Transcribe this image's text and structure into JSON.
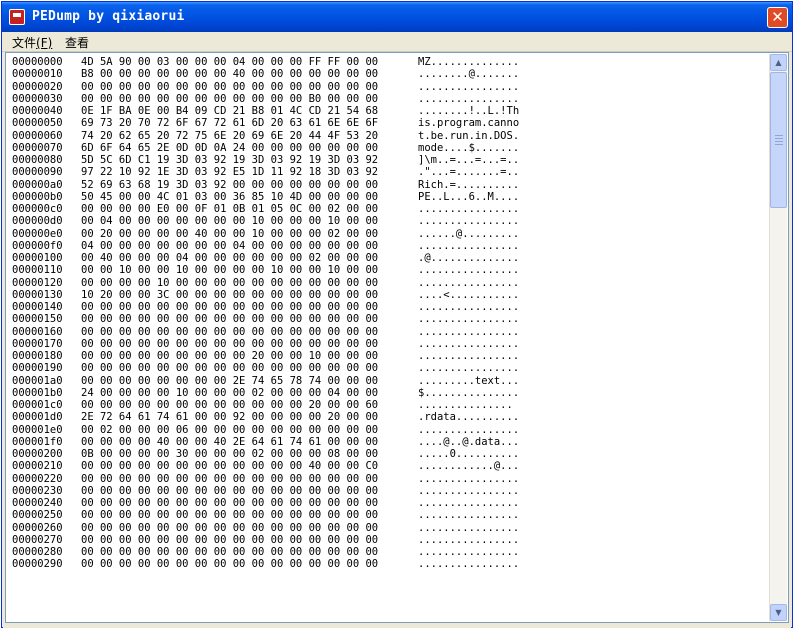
{
  "window": {
    "title": "PEDump by qixiaorui",
    "close_glyph": "✕"
  },
  "menu": [
    {
      "label": "文件",
      "accel": "(F)"
    },
    {
      "label": "查看",
      "accel": ""
    }
  ],
  "scrollbar": {
    "up_arrow": "▲",
    "down_arrow": "▼"
  },
  "hex_rows": [
    {
      "offset": "00000000",
      "hex": "4D 5A 90 00 03 00 00 00 04 00 00 00 FF FF 00 00",
      "ascii": "MZ.............."
    },
    {
      "offset": "00000010",
      "hex": "B8 00 00 00 00 00 00 00 40 00 00 00 00 00 00 00",
      "ascii": "........@......."
    },
    {
      "offset": "00000020",
      "hex": "00 00 00 00 00 00 00 00 00 00 00 00 00 00 00 00",
      "ascii": "................"
    },
    {
      "offset": "00000030",
      "hex": "00 00 00 00 00 00 00 00 00 00 00 00 B0 00 00 00",
      "ascii": "................"
    },
    {
      "offset": "00000040",
      "hex": "0E 1F BA 0E 00 B4 09 CD 21 B8 01 4C CD 21 54 68",
      "ascii": "........!..L.!Th"
    },
    {
      "offset": "00000050",
      "hex": "69 73 20 70 72 6F 67 72 61 6D 20 63 61 6E 6E 6F",
      "ascii": "is.program.canno"
    },
    {
      "offset": "00000060",
      "hex": "74 20 62 65 20 72 75 6E 20 69 6E 20 44 4F 53 20",
      "ascii": "t.be.run.in.DOS."
    },
    {
      "offset": "00000070",
      "hex": "6D 6F 64 65 2E 0D 0D 0A 24 00 00 00 00 00 00 00",
      "ascii": "mode....$......."
    },
    {
      "offset": "00000080",
      "hex": "5D 5C 6D C1 19 3D 03 92 19 3D 03 92 19 3D 03 92",
      "ascii": "]\\m..=...=...=.."
    },
    {
      "offset": "00000090",
      "hex": "97 22 10 92 1E 3D 03 92 E5 1D 11 92 18 3D 03 92",
      "ascii": ".\"...=.......=.."
    },
    {
      "offset": "000000a0",
      "hex": "52 69 63 68 19 3D 03 92 00 00 00 00 00 00 00 00",
      "ascii": "Rich.=.........."
    },
    {
      "offset": "000000b0",
      "hex": "50 45 00 00 4C 01 03 00 36 85 10 4D 00 00 00 00",
      "ascii": "PE..L...6..M...."
    },
    {
      "offset": "000000c0",
      "hex": "00 00 00 00 E0 00 0F 01 0B 01 05 0C 00 02 00 00",
      "ascii": "................"
    },
    {
      "offset": "000000d0",
      "hex": "00 04 00 00 00 00 00 00 00 10 00 00 00 10 00 00",
      "ascii": "................"
    },
    {
      "offset": "000000e0",
      "hex": "00 20 00 00 00 00 40 00 00 10 00 00 00 02 00 00",
      "ascii": "......@........."
    },
    {
      "offset": "000000f0",
      "hex": "04 00 00 00 00 00 00 00 04 00 00 00 00 00 00 00",
      "ascii": "................"
    },
    {
      "offset": "00000100",
      "hex": "00 40 00 00 00 04 00 00 00 00 00 00 02 00 00 00",
      "ascii": ".@.............."
    },
    {
      "offset": "00000110",
      "hex": "00 00 10 00 00 10 00 00 00 00 10 00 00 10 00 00",
      "ascii": "................"
    },
    {
      "offset": "00000120",
      "hex": "00 00 00 00 10 00 00 00 00 00 00 00 00 00 00 00",
      "ascii": "................"
    },
    {
      "offset": "00000130",
      "hex": "10 20 00 00 3C 00 00 00 00 00 00 00 00 00 00 00",
      "ascii": "....<..........."
    },
    {
      "offset": "00000140",
      "hex": "00 00 00 00 00 00 00 00 00 00 00 00 00 00 00 00",
      "ascii": "................"
    },
    {
      "offset": "00000150",
      "hex": "00 00 00 00 00 00 00 00 00 00 00 00 00 00 00 00",
      "ascii": "................"
    },
    {
      "offset": "00000160",
      "hex": "00 00 00 00 00 00 00 00 00 00 00 00 00 00 00 00",
      "ascii": "................"
    },
    {
      "offset": "00000170",
      "hex": "00 00 00 00 00 00 00 00 00 00 00 00 00 00 00 00",
      "ascii": "................"
    },
    {
      "offset": "00000180",
      "hex": "00 00 00 00 00 00 00 00 00 20 00 00 10 00 00 00",
      "ascii": "................"
    },
    {
      "offset": "00000190",
      "hex": "00 00 00 00 00 00 00 00 00 00 00 00 00 00 00 00",
      "ascii": "................"
    },
    {
      "offset": "000001a0",
      "hex": "00 00 00 00 00 00 00 00 2E 74 65 78 74 00 00 00",
      "ascii": ".........text..."
    },
    {
      "offset": "000001b0",
      "hex": "24 00 00 00 00 10 00 00 00 02 00 00 00 04 00 00",
      "ascii": "$..............."
    },
    {
      "offset": "000001c0",
      "hex": "00 00 00 00 00 00 00 00 00 00 00 00 20 00 00 60",
      "ascii": "..............."
    },
    {
      "offset": "000001d0",
      "hex": "2E 72 64 61 74 61 00 00 92 00 00 00 00 20 00 00",
      "ascii": ".rdata.........."
    },
    {
      "offset": "000001e0",
      "hex": "00 02 00 00 00 06 00 00 00 00 00 00 00 00 00 00",
      "ascii": "................"
    },
    {
      "offset": "000001f0",
      "hex": "00 00 00 00 40 00 00 40 2E 64 61 74 61 00 00 00",
      "ascii": "....@..@.data..."
    },
    {
      "offset": "00000200",
      "hex": "0B 00 00 00 00 30 00 00 00 02 00 00 00 08 00 00",
      "ascii": ".....0.........."
    },
    {
      "offset": "00000210",
      "hex": "00 00 00 00 00 00 00 00 00 00 00 00 40 00 00 C0",
      "ascii": "............@..."
    },
    {
      "offset": "00000220",
      "hex": "00 00 00 00 00 00 00 00 00 00 00 00 00 00 00 00",
      "ascii": "................"
    },
    {
      "offset": "00000230",
      "hex": "00 00 00 00 00 00 00 00 00 00 00 00 00 00 00 00",
      "ascii": "................"
    },
    {
      "offset": "00000240",
      "hex": "00 00 00 00 00 00 00 00 00 00 00 00 00 00 00 00",
      "ascii": "................"
    },
    {
      "offset": "00000250",
      "hex": "00 00 00 00 00 00 00 00 00 00 00 00 00 00 00 00",
      "ascii": "................"
    },
    {
      "offset": "00000260",
      "hex": "00 00 00 00 00 00 00 00 00 00 00 00 00 00 00 00",
      "ascii": "................"
    },
    {
      "offset": "00000270",
      "hex": "00 00 00 00 00 00 00 00 00 00 00 00 00 00 00 00",
      "ascii": "................"
    },
    {
      "offset": "00000280",
      "hex": "00 00 00 00 00 00 00 00 00 00 00 00 00 00 00 00",
      "ascii": "................"
    },
    {
      "offset": "00000290",
      "hex": "00 00 00 00 00 00 00 00 00 00 00 00 00 00 00 00",
      "ascii": "................"
    }
  ]
}
